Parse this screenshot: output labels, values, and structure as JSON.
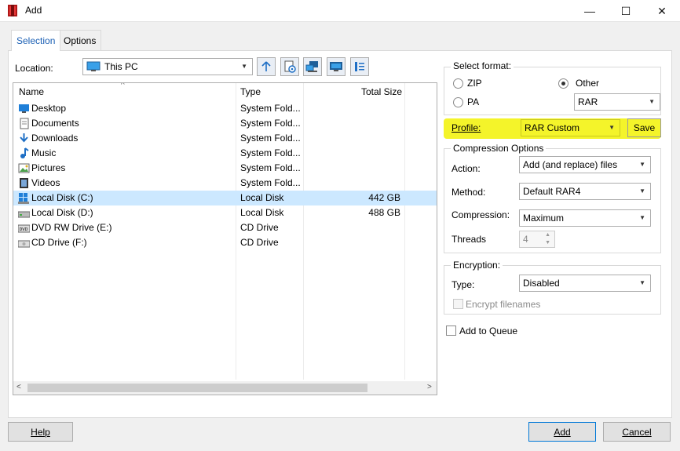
{
  "window": {
    "title": "Add",
    "minimize_glyph": "—",
    "maximize_glyph": "☐",
    "close_glyph": "✕"
  },
  "tabs": [
    {
      "label": "Selection"
    },
    {
      "label": "Options"
    }
  ],
  "location": {
    "label": "Location:",
    "value": "This PC"
  },
  "toolbar": [
    "up-folder",
    "folder-options",
    "computer",
    "desktop",
    "list-view"
  ],
  "file_list": {
    "columns": {
      "name": "Name",
      "type": "Type",
      "size": "Total Size"
    },
    "rows": [
      {
        "name": "Desktop",
        "type": "System Fold...",
        "size": "",
        "icon": "desktop-icon"
      },
      {
        "name": "Documents",
        "type": "System Fold...",
        "size": "",
        "icon": "documents-icon"
      },
      {
        "name": "Downloads",
        "type": "System Fold...",
        "size": "",
        "icon": "downloads-icon"
      },
      {
        "name": "Music",
        "type": "System Fold...",
        "size": "",
        "icon": "music-icon"
      },
      {
        "name": "Pictures",
        "type": "System Fold...",
        "size": "",
        "icon": "pictures-icon"
      },
      {
        "name": "Videos",
        "type": "System Fold...",
        "size": "",
        "icon": "videos-icon"
      },
      {
        "name": "Local Disk (C:)",
        "type": "Local Disk",
        "size": "442 GB",
        "icon": "windows-disk-icon",
        "selected": true
      },
      {
        "name": "Local Disk (D:)",
        "type": "Local Disk",
        "size": "488 GB",
        "icon": "disk-icon"
      },
      {
        "name": "DVD RW Drive (E:)",
        "type": "CD Drive",
        "size": "",
        "icon": "dvd-icon"
      },
      {
        "name": "CD Drive (F:)",
        "type": "CD Drive",
        "size": "",
        "icon": "cd-icon"
      }
    ]
  },
  "select_format": {
    "title": "Select format:",
    "zip_label": "ZIP",
    "pa_label": "PA",
    "other_label": "Other",
    "other_value": "RAR",
    "selected": "Other"
  },
  "profile": {
    "label": "Profile:",
    "value": "RAR Custom",
    "save_label": "Save"
  },
  "compression": {
    "title": "Compression Options",
    "action_label": "Action:",
    "action_value": "Add (and replace) files",
    "method_label": "Method:",
    "method_value": "Default RAR4",
    "compression_label": "Compression:",
    "compression_value": "Maximum",
    "threads_label": "Threads",
    "threads_value": "4"
  },
  "encryption": {
    "title": "Encryption:",
    "type_label": "Type:",
    "type_value": "Disabled",
    "encrypt_filenames_label": "Encrypt filenames"
  },
  "add_to_queue_label": "Add to Queue",
  "buttons": {
    "help": "Help",
    "add": "Add",
    "cancel": "Cancel"
  },
  "colors": {
    "highlight": "#f4f42a",
    "selected_row": "#cce8ff",
    "tab_active_text": "#1a5fb4",
    "default_button_border": "#0078d7"
  }
}
